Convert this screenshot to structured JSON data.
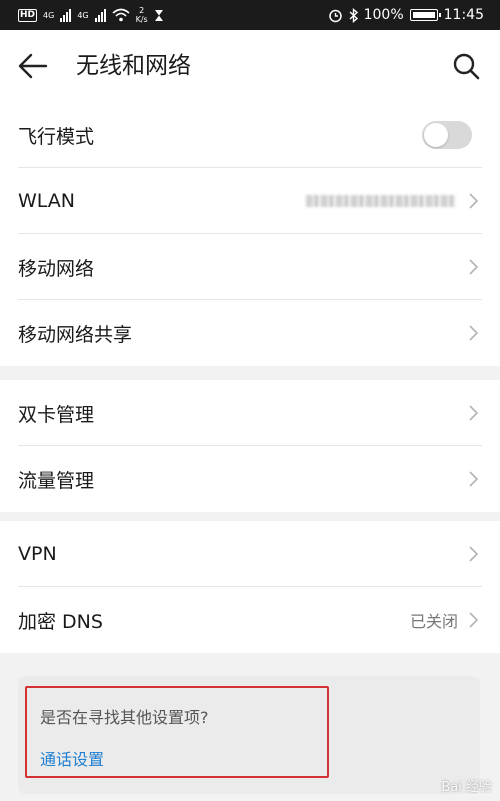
{
  "status_bar": {
    "left_badge": "HD",
    "net1": "4G",
    "net2": "4G",
    "speed_value": "2",
    "speed_unit": "K/s",
    "battery": "100%",
    "time": "11:45"
  },
  "header": {
    "title": "无线和网络"
  },
  "groups": [
    {
      "items": [
        {
          "label": "飞行模式",
          "control": "toggle",
          "toggle_on": false
        },
        {
          "label": "WLAN",
          "control": "chevron"
        },
        {
          "label": "移动网络",
          "control": "chevron"
        },
        {
          "label": "移动网络共享",
          "control": "chevron"
        }
      ]
    },
    {
      "items": [
        {
          "label": "双卡管理",
          "control": "chevron"
        },
        {
          "label": "流量管理",
          "control": "chevron"
        }
      ]
    },
    {
      "items": [
        {
          "label": "VPN",
          "control": "chevron"
        },
        {
          "label": "加密 DNS",
          "control": "chevron",
          "value": "已关闭"
        }
      ]
    }
  ],
  "suggestion": {
    "question": "是否在寻找其他设置项?",
    "link": "通话设置"
  },
  "colors": {
    "link": "#1f7fd1",
    "highlight_box": "#d23232",
    "toggle_off": "#d9d9d9"
  },
  "watermark": "Bai 经验"
}
